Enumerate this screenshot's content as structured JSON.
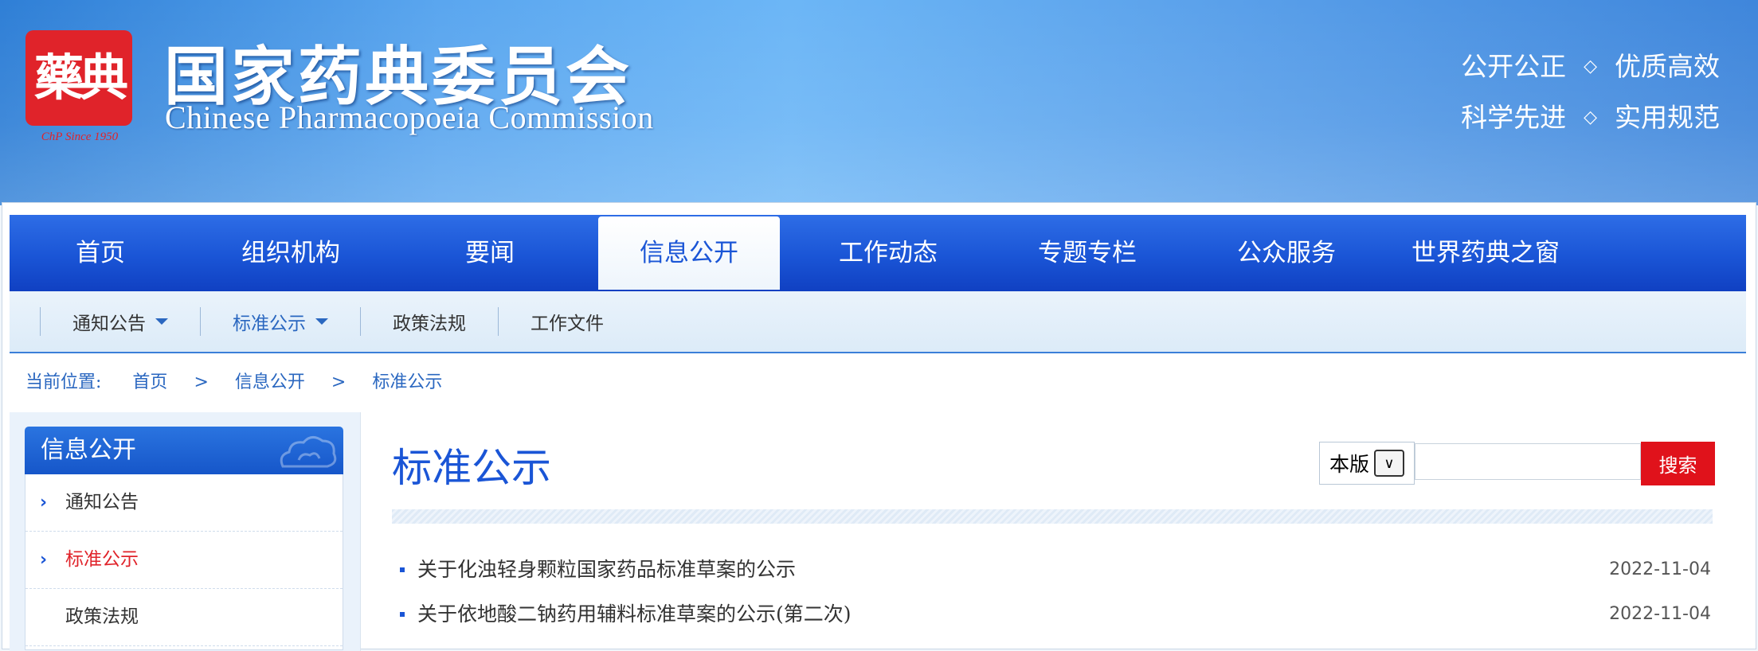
{
  "header": {
    "logo_seal": "藥典",
    "logo_caption": "ChP Since 1950",
    "site_title": "国家药典委员会",
    "site_subtitle": "Chinese Pharmacopoeia Commission",
    "slogans": [
      [
        "公开公正",
        "优质高效"
      ],
      [
        "科学先进",
        "实用规范"
      ]
    ],
    "slogan_separator": "◇"
  },
  "main_nav": {
    "items": [
      {
        "label": "首页"
      },
      {
        "label": "组织机构"
      },
      {
        "label": "要闻"
      },
      {
        "label": "信息公开",
        "active": true
      },
      {
        "label": "工作动态"
      },
      {
        "label": "专题专栏"
      },
      {
        "label": "公众服务"
      },
      {
        "label": "世界药典之窗"
      }
    ]
  },
  "sub_nav": {
    "items": [
      {
        "label": "通知公告",
        "dropdown": true
      },
      {
        "label": "标准公示",
        "dropdown": true,
        "active": true
      },
      {
        "label": "政策法规"
      },
      {
        "label": "工作文件"
      }
    ]
  },
  "breadcrumb": {
    "label": "当前位置:",
    "items": [
      "首页",
      "信息公开",
      "标准公示"
    ],
    "separator": ">"
  },
  "sidebar": {
    "title": "信息公开",
    "items": [
      {
        "label": "通知公告"
      },
      {
        "label": "标准公示",
        "active": true
      },
      {
        "label": "政策法规"
      }
    ]
  },
  "content": {
    "title": "标准公示",
    "search": {
      "scope_value": "本版",
      "placeholder": "",
      "button_label": "搜索"
    },
    "news": [
      {
        "title": "关于化浊轻身颗粒国家药品标准草案的公示",
        "date": "2022-11-04"
      },
      {
        "title": "关于依地酸二钠药用辅料标准草案的公示(第二次)",
        "date": "2022-11-04"
      }
    ]
  },
  "colors": {
    "brand_blue": "#1a55d6",
    "accent_red": "#e0121b",
    "active_side_text": "#e0232a"
  }
}
